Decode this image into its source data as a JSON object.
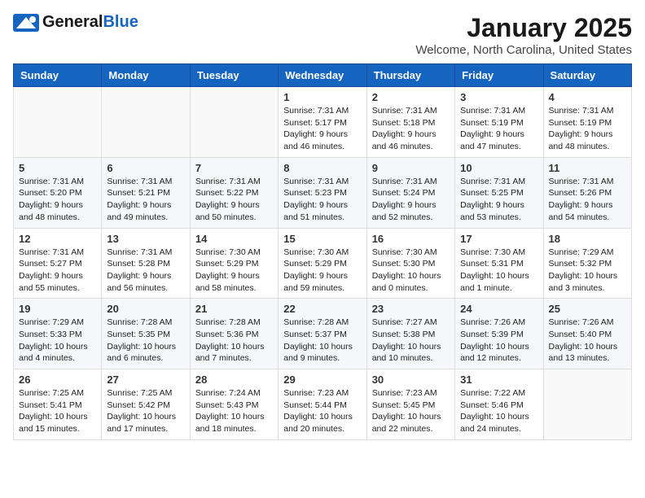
{
  "header": {
    "logo_general": "General",
    "logo_blue": "Blue",
    "month": "January 2025",
    "location": "Welcome, North Carolina, United States"
  },
  "weekdays": [
    "Sunday",
    "Monday",
    "Tuesday",
    "Wednesday",
    "Thursday",
    "Friday",
    "Saturday"
  ],
  "weeks": [
    [
      {
        "day": "",
        "info": ""
      },
      {
        "day": "",
        "info": ""
      },
      {
        "day": "",
        "info": ""
      },
      {
        "day": "1",
        "info": "Sunrise: 7:31 AM\nSunset: 5:17 PM\nDaylight: 9 hours\nand 46 minutes."
      },
      {
        "day": "2",
        "info": "Sunrise: 7:31 AM\nSunset: 5:18 PM\nDaylight: 9 hours\nand 46 minutes."
      },
      {
        "day": "3",
        "info": "Sunrise: 7:31 AM\nSunset: 5:19 PM\nDaylight: 9 hours\nand 47 minutes."
      },
      {
        "day": "4",
        "info": "Sunrise: 7:31 AM\nSunset: 5:19 PM\nDaylight: 9 hours\nand 48 minutes."
      }
    ],
    [
      {
        "day": "5",
        "info": "Sunrise: 7:31 AM\nSunset: 5:20 PM\nDaylight: 9 hours\nand 48 minutes."
      },
      {
        "day": "6",
        "info": "Sunrise: 7:31 AM\nSunset: 5:21 PM\nDaylight: 9 hours\nand 49 minutes."
      },
      {
        "day": "7",
        "info": "Sunrise: 7:31 AM\nSunset: 5:22 PM\nDaylight: 9 hours\nand 50 minutes."
      },
      {
        "day": "8",
        "info": "Sunrise: 7:31 AM\nSunset: 5:23 PM\nDaylight: 9 hours\nand 51 minutes."
      },
      {
        "day": "9",
        "info": "Sunrise: 7:31 AM\nSunset: 5:24 PM\nDaylight: 9 hours\nand 52 minutes."
      },
      {
        "day": "10",
        "info": "Sunrise: 7:31 AM\nSunset: 5:25 PM\nDaylight: 9 hours\nand 53 minutes."
      },
      {
        "day": "11",
        "info": "Sunrise: 7:31 AM\nSunset: 5:26 PM\nDaylight: 9 hours\nand 54 minutes."
      }
    ],
    [
      {
        "day": "12",
        "info": "Sunrise: 7:31 AM\nSunset: 5:27 PM\nDaylight: 9 hours\nand 55 minutes."
      },
      {
        "day": "13",
        "info": "Sunrise: 7:31 AM\nSunset: 5:28 PM\nDaylight: 9 hours\nand 56 minutes."
      },
      {
        "day": "14",
        "info": "Sunrise: 7:30 AM\nSunset: 5:29 PM\nDaylight: 9 hours\nand 58 minutes."
      },
      {
        "day": "15",
        "info": "Sunrise: 7:30 AM\nSunset: 5:29 PM\nDaylight: 9 hours\nand 59 minutes."
      },
      {
        "day": "16",
        "info": "Sunrise: 7:30 AM\nSunset: 5:30 PM\nDaylight: 10 hours\nand 0 minutes."
      },
      {
        "day": "17",
        "info": "Sunrise: 7:30 AM\nSunset: 5:31 PM\nDaylight: 10 hours\nand 1 minute."
      },
      {
        "day": "18",
        "info": "Sunrise: 7:29 AM\nSunset: 5:32 PM\nDaylight: 10 hours\nand 3 minutes."
      }
    ],
    [
      {
        "day": "19",
        "info": "Sunrise: 7:29 AM\nSunset: 5:33 PM\nDaylight: 10 hours\nand 4 minutes."
      },
      {
        "day": "20",
        "info": "Sunrise: 7:28 AM\nSunset: 5:35 PM\nDaylight: 10 hours\nand 6 minutes."
      },
      {
        "day": "21",
        "info": "Sunrise: 7:28 AM\nSunset: 5:36 PM\nDaylight: 10 hours\nand 7 minutes."
      },
      {
        "day": "22",
        "info": "Sunrise: 7:28 AM\nSunset: 5:37 PM\nDaylight: 10 hours\nand 9 minutes."
      },
      {
        "day": "23",
        "info": "Sunrise: 7:27 AM\nSunset: 5:38 PM\nDaylight: 10 hours\nand 10 minutes."
      },
      {
        "day": "24",
        "info": "Sunrise: 7:26 AM\nSunset: 5:39 PM\nDaylight: 10 hours\nand 12 minutes."
      },
      {
        "day": "25",
        "info": "Sunrise: 7:26 AM\nSunset: 5:40 PM\nDaylight: 10 hours\nand 13 minutes."
      }
    ],
    [
      {
        "day": "26",
        "info": "Sunrise: 7:25 AM\nSunset: 5:41 PM\nDaylight: 10 hours\nand 15 minutes."
      },
      {
        "day": "27",
        "info": "Sunrise: 7:25 AM\nSunset: 5:42 PM\nDaylight: 10 hours\nand 17 minutes."
      },
      {
        "day": "28",
        "info": "Sunrise: 7:24 AM\nSunset: 5:43 PM\nDaylight: 10 hours\nand 18 minutes."
      },
      {
        "day": "29",
        "info": "Sunrise: 7:23 AM\nSunset: 5:44 PM\nDaylight: 10 hours\nand 20 minutes."
      },
      {
        "day": "30",
        "info": "Sunrise: 7:23 AM\nSunset: 5:45 PM\nDaylight: 10 hours\nand 22 minutes."
      },
      {
        "day": "31",
        "info": "Sunrise: 7:22 AM\nSunset: 5:46 PM\nDaylight: 10 hours\nand 24 minutes."
      },
      {
        "day": "",
        "info": ""
      }
    ]
  ]
}
